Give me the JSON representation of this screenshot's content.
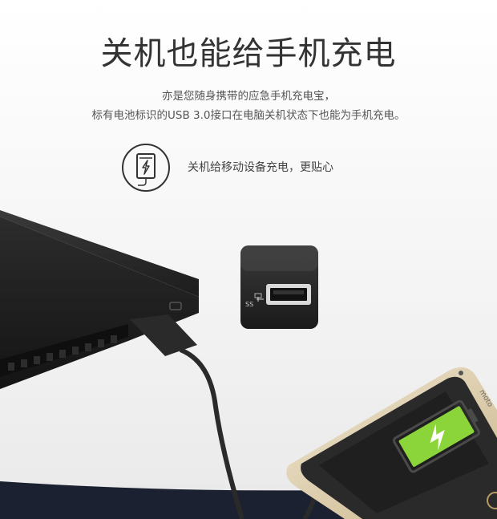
{
  "heading": "关机也能给手机充电",
  "description": {
    "line1": "亦是您随身携带的应急手机充电宝，",
    "line2": "标有电池标识的USB 3.0接口在电脑关机状态下也能为手机充电。"
  },
  "feature": {
    "icon": "phone-charging-icon",
    "text": "关机给移动设备充电，更贴心"
  },
  "closeup": {
    "port_label": "SS"
  },
  "phone": {
    "brand": "moto",
    "battery_icon": "battery-charging-icon",
    "battery_color": "#8bd43a"
  }
}
